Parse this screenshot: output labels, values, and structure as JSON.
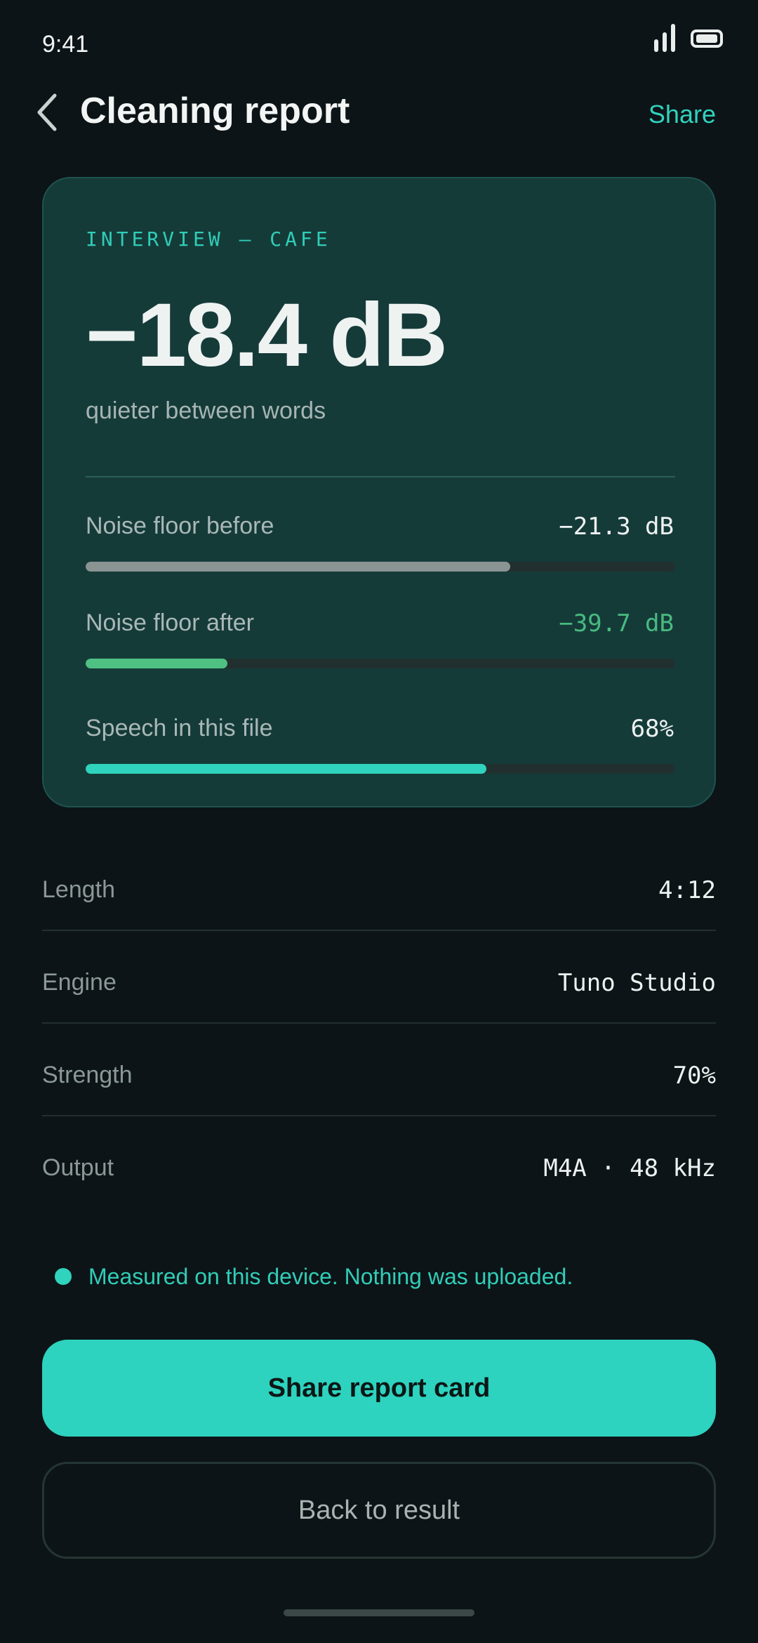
{
  "status_bar": {
    "time": "9:41"
  },
  "header": {
    "title": "Cleaning report",
    "share_label": "Share"
  },
  "summary": {
    "label": "INTERVIEW — CAFE",
    "headline_value": "−18.4 dB",
    "headline_caption": "quieter between words",
    "metrics": [
      {
        "label": "Noise floor before",
        "value": "−21.3 dB",
        "fill_fraction": 0.72,
        "color": "#8a9492",
        "value_color": "#edf2f1"
      },
      {
        "label": "Noise floor after",
        "value": "−39.7 dB",
        "fill_fraction": 0.24,
        "color": "#4fc183",
        "value_color": "#48bb80"
      },
      {
        "label": "Speech in this file",
        "value": "68%",
        "fill_fraction": 0.68,
        "color": "#2fd3be",
        "value_color": "#edf2f1"
      }
    ]
  },
  "details": [
    {
      "label": "Length",
      "value": "4:12"
    },
    {
      "label": "Engine",
      "value": "Tuno Studio"
    },
    {
      "label": "Strength",
      "value": "70%"
    },
    {
      "label": "Output",
      "value": "M4A · 48 kHz"
    }
  ],
  "note": {
    "text": "Measured on this device. Nothing was uploaded."
  },
  "actions": {
    "primary_label": "Share report card",
    "secondary_label": "Back to result"
  },
  "colors": {
    "accent": "#2dd3be",
    "background": "#0c1417",
    "card": "#153b39"
  }
}
